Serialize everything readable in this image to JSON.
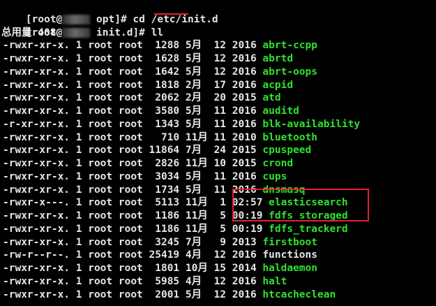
{
  "terminal": {
    "commands": [
      {
        "prompt_start": "[root@",
        "prompt_end": " opt]# ",
        "command": "cd /etc/init.d"
      },
      {
        "prompt_start": "[root@",
        "prompt_end": " init.d]# ",
        "command": "ll"
      }
    ],
    "total_line": "总用量 408",
    "entries": [
      {
        "meta": "-rwxr-xr-x. 1 root root  1288 5月  12 2016 ",
        "name": "abrt-ccpp",
        "executable": true
      },
      {
        "meta": "-rwxr-xr-x. 1 root root  1628 5月  12 2016 ",
        "name": "abrtd",
        "executable": true
      },
      {
        "meta": "-rwxr-xr-x. 1 root root  1642 5月  12 2016 ",
        "name": "abrt-oops",
        "executable": true
      },
      {
        "meta": "-rwxr-xr-x. 1 root root  1818 2月  17 2016 ",
        "name": "acpid",
        "executable": true
      },
      {
        "meta": "-rwxr-xr-x. 1 root root  2062 2月  20 2015 ",
        "name": "atd",
        "executable": true
      },
      {
        "meta": "-rwxr-xr-x. 1 root root  3580 5月  11 2016 ",
        "name": "auditd",
        "executable": true
      },
      {
        "meta": "-r-xr-xr-x. 1 root root  1343 5月  11 2016 ",
        "name": "blk-availability",
        "executable": true
      },
      {
        "meta": "-rwxr-xr-x. 1 root root   710 11月 11 2010 ",
        "name": "bluetooth",
        "executable": true
      },
      {
        "meta": "-rwxr-xr-x. 1 root root 11864 7月  24 2015 ",
        "name": "cpuspeed",
        "executable": true
      },
      {
        "meta": "-rwxr-xr-x. 1 root root  2826 11月 10 2015 ",
        "name": "crond",
        "executable": true
      },
      {
        "meta": "-rwxr-xr-x. 1 root root  3034 5月  11 2016 ",
        "name": "cups",
        "executable": true
      },
      {
        "meta": "-rwxr-xr-x. 1 root root  1734 5月  11 2016 ",
        "name": "dnsmasq",
        "executable": true
      },
      {
        "meta": "-rwxr-x---. 1 root root  5113 11月  1 02:57 ",
        "name": "elasticsearch",
        "executable": true
      },
      {
        "meta": "-rwxr-xr-x. 1 root root  1186 11月  5 00:19 ",
        "name": "fdfs_storaged",
        "executable": true
      },
      {
        "meta": "-rwxr-xr-x. 1 root root  1186 11月  5 00:19 ",
        "name": "fdfs_trackerd",
        "executable": true
      },
      {
        "meta": "-rwxr-xr-x. 1 root root  3245 7月   9 2013 ",
        "name": "firstboot",
        "executable": true
      },
      {
        "meta": "-rw-r--r--. 1 root root 25419 4月  12 2016 ",
        "name": "functions",
        "executable": false
      },
      {
        "meta": "-rwxr-xr-x. 1 root root  1801 10月 15 2014 ",
        "name": "haldaemon",
        "executable": true
      },
      {
        "meta": "-rwxr-xr-x. 1 root root  5985 4月  12 2016 ",
        "name": "halt",
        "executable": true
      },
      {
        "meta": "-rwxr-xr-x. 1 root root  2001 5月  12 2016 ",
        "name": "htcacheclean",
        "executable": true
      }
    ],
    "colors": {
      "background": "#000000",
      "text": "#e6e6e6",
      "executable": "#2ee22e",
      "annotation": "#e5202a"
    }
  }
}
